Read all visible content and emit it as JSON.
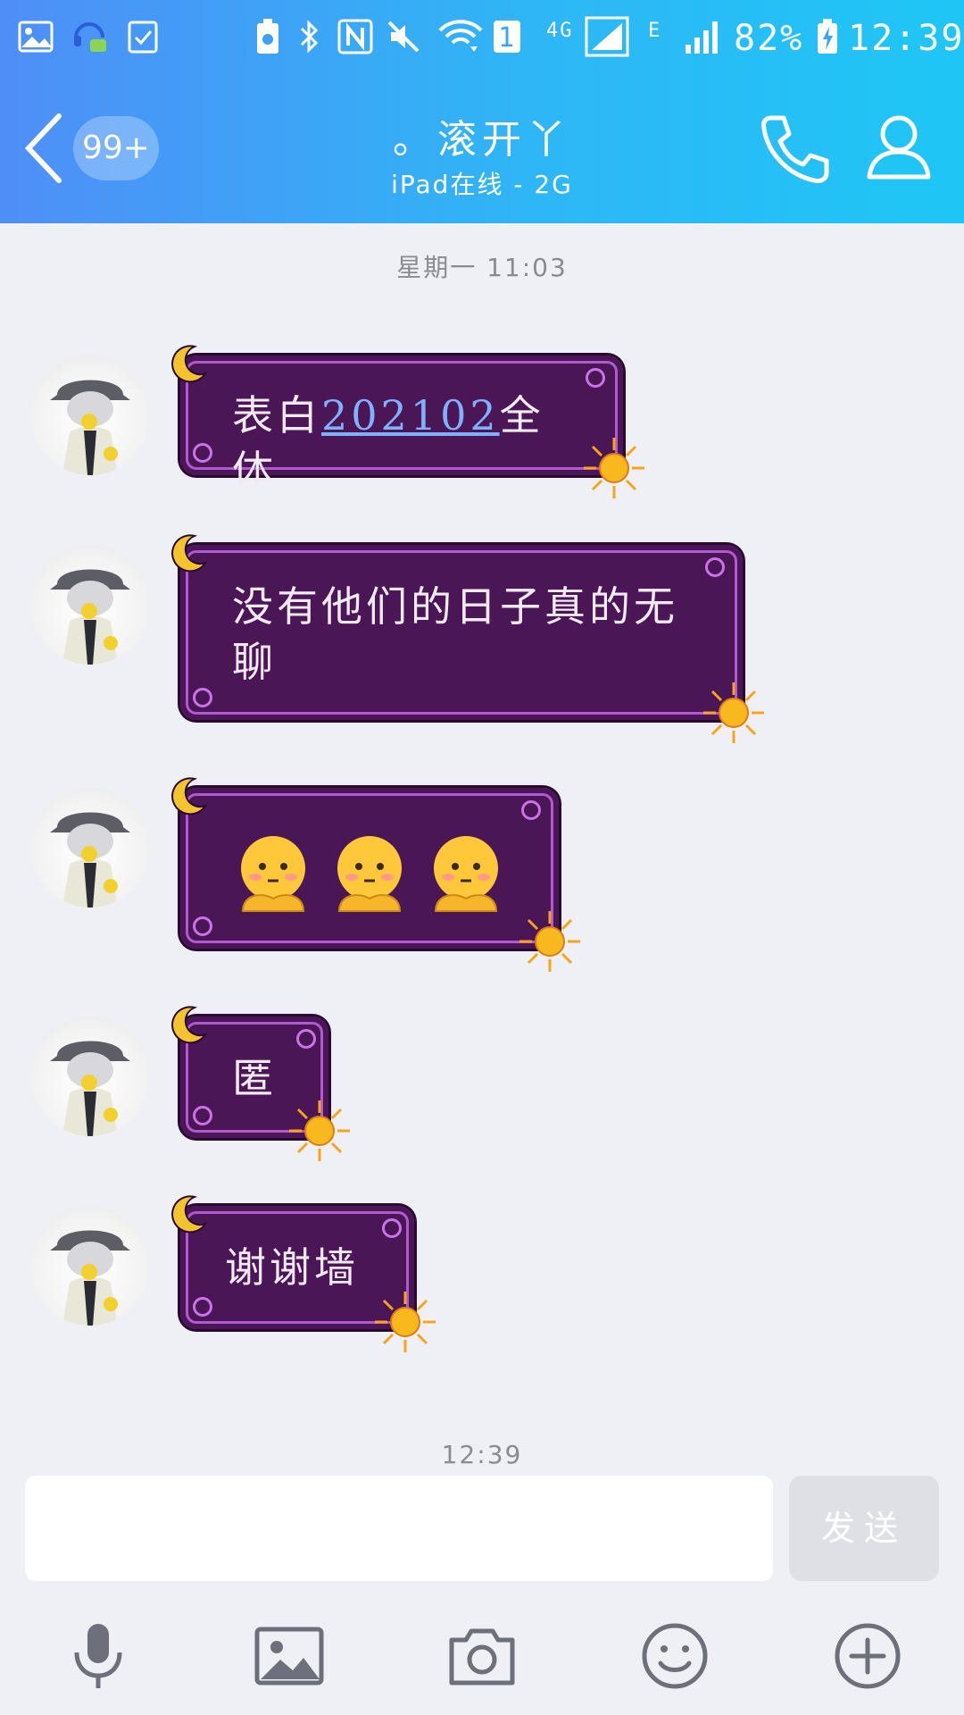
{
  "status_bar": {
    "network_4g": "4G",
    "network_e": "E",
    "sim_badge": "1",
    "battery_percent": "82%",
    "time": "12:39"
  },
  "header": {
    "unread_badge": "99+",
    "contact_name": "。滚开丫",
    "contact_status": "iPad在线 - 2G",
    "bg_gradient": [
      "#4f8ef7",
      "#1ec6f5"
    ]
  },
  "chat": {
    "time_separator_top": "星期一 11:03",
    "time_separator_bottom": "12:39",
    "bubble_color": "#4a1656",
    "messages": [
      {
        "text_before": "表白",
        "link": "202102",
        "text_after": "全体"
      },
      {
        "text": "没有他们的日子真的无聊"
      },
      {
        "emoji": [
          "shy-face-emoji",
          "shy-face-emoji",
          "shy-face-emoji"
        ]
      },
      {
        "text": "匿"
      },
      {
        "text": "谢谢墙"
      }
    ]
  },
  "composer": {
    "input_value": "",
    "send_label": "发送"
  },
  "toolbar": {
    "items": [
      "microphone-icon",
      "image-icon",
      "camera-icon",
      "emoji-icon",
      "plus-icon"
    ]
  }
}
